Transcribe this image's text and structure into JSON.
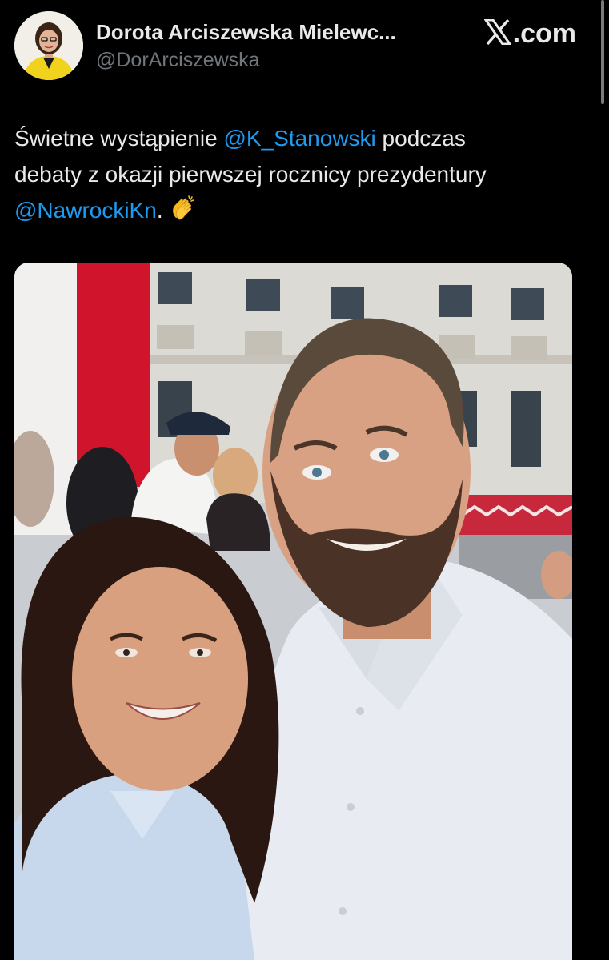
{
  "author": {
    "display_name": "Dorota Arciszewska Mielewc...",
    "handle": "@DorArciszewska"
  },
  "brand": {
    "label": ".com",
    "icon": "x-logo-icon"
  },
  "tweet": {
    "line1_pre": "Świetne wystąpienie ",
    "mention1": "@K_Stanowski",
    "line1_post": " podczas",
    "line2": "debaty z okazji pierwszej rocznicy prezydentury",
    "mention2": "@NawrockiKn",
    "line3_post": ". ",
    "emoji_icon": "clapping-hands-icon"
  },
  "media": {
    "icon": "photo-selfie"
  },
  "colors": {
    "background": "#000000",
    "text": "#e7e9ea",
    "secondary": "#71767b",
    "mention": "#1d9bf0"
  }
}
